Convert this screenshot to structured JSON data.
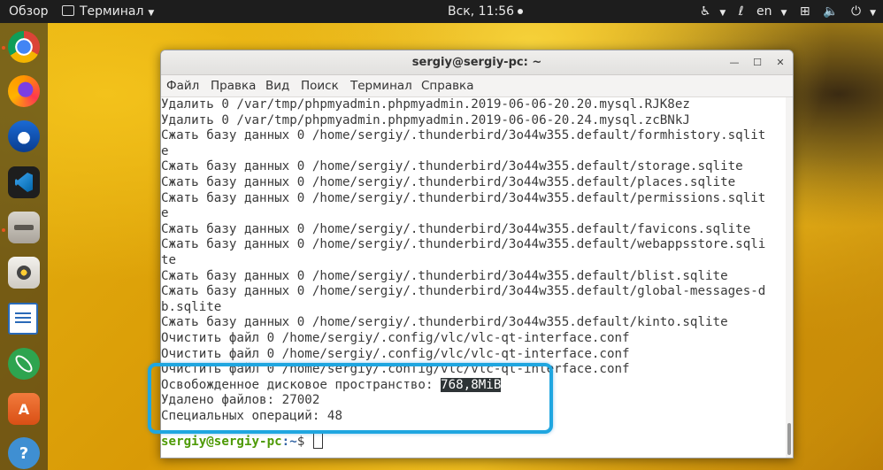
{
  "topbar": {
    "activities": "Обзор",
    "app_menu": "Терминал",
    "clock": "Вск, 11:56",
    "language": "en"
  },
  "dock": {
    "items": [
      "chrome-icon",
      "firefox-icon",
      "thunderbird-icon",
      "vscode-icon",
      "files-icon",
      "rhythmbox-icon",
      "libreoffice-writer-icon",
      "atom-icon",
      "software-center-icon",
      "help-icon"
    ]
  },
  "window": {
    "title": "sergiy@sergiy-pc: ~",
    "menu": [
      "Файл",
      "Правка",
      "Вид",
      "Поиск",
      "Терминал",
      "Справка"
    ]
  },
  "terminal": {
    "lines": [
      "Удалить 0 /var/tmp/phpmyadmin.phpmyadmin.2019-06-06-20.20.mysql.RJK8ez",
      "Удалить 0 /var/tmp/phpmyadmin.phpmyadmin.2019-06-06-20.24.mysql.zcBNkJ",
      "Сжать базу данных 0 /home/sergiy/.thunderbird/3o44w355.default/formhistory.sqlit",
      "e",
      "Сжать базу данных 0 /home/sergiy/.thunderbird/3o44w355.default/storage.sqlite",
      "Сжать базу данных 0 /home/sergiy/.thunderbird/3o44w355.default/places.sqlite",
      "Сжать базу данных 0 /home/sergiy/.thunderbird/3o44w355.default/permissions.sqlit",
      "e",
      "Сжать базу данных 0 /home/sergiy/.thunderbird/3o44w355.default/favicons.sqlite",
      "Сжать базу данных 0 /home/sergiy/.thunderbird/3o44w355.default/webappsstore.sqli",
      "te",
      "Сжать базу данных 0 /home/sergiy/.thunderbird/3o44w355.default/blist.sqlite",
      "Сжать базу данных 0 /home/sergiy/.thunderbird/3o44w355.default/global-messages-d",
      "b.sqlite",
      "Сжать базу данных 0 /home/sergiy/.thunderbird/3o44w355.default/kinto.sqlite",
      "Очистить файл 0 /home/sergiy/.config/vlc/vlc-qt-interface.conf",
      "Очистить файл 0 /home/sergiy/.config/vlc/vlc-qt-interface.conf",
      "Очистить файл 0 /home/sergiy/.config/vlc/vlc-qt-interface.conf"
    ],
    "freed_label": "Освобожденное дисковое пространство: ",
    "freed_value": "768,8MiB",
    "deleted_files": "Удалено файлов: 27002",
    "special_ops": "Специальных операций: 48",
    "prompt_user": "sergiy@sergiy-pc",
    "prompt_path": ":~",
    "prompt_symbol": "$ "
  },
  "colors": {
    "highlight": "#1fa6e0",
    "prompt_user": "#4e9a06",
    "prompt_path": "#3465a4"
  }
}
